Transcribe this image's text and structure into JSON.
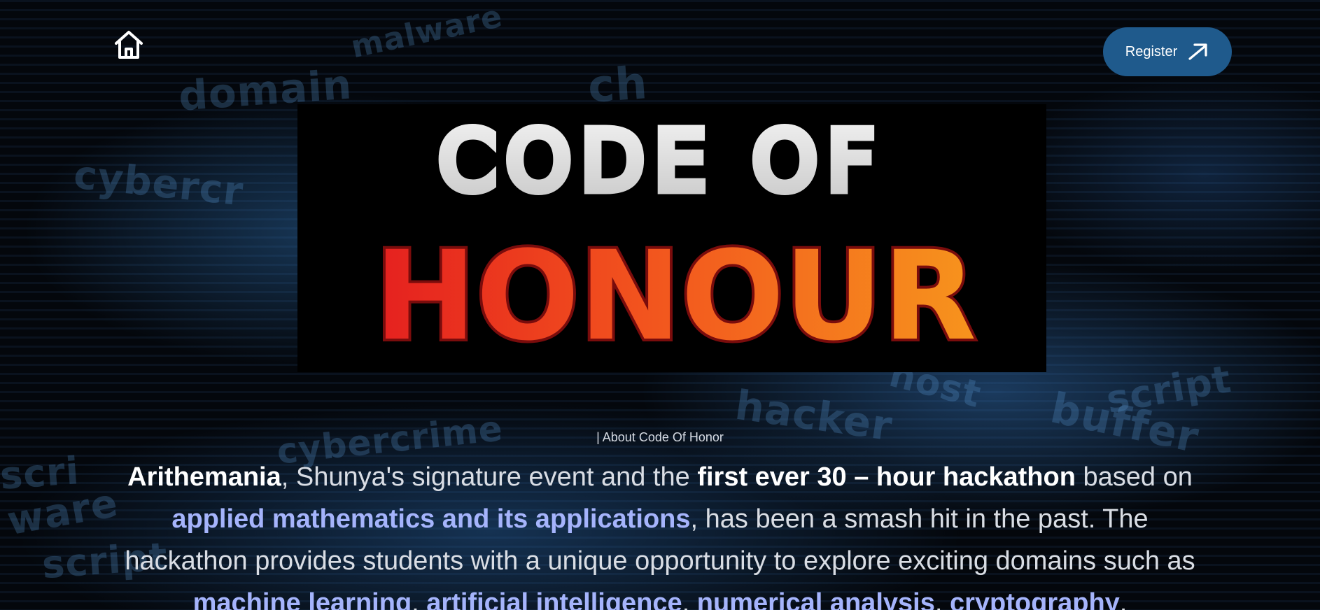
{
  "nav": {
    "home_icon": "home-icon",
    "register_label": "Register",
    "register_icon": "arrow-up-right-icon",
    "register_color": "#1f5a8c"
  },
  "logo": {
    "line1": "CODE OF",
    "line2": "HONOUR"
  },
  "background_words": [
    "domain",
    "malware",
    "cybercr",
    "ch",
    "host",
    "buffer",
    "hacker",
    "script",
    "cybercrime",
    "scri",
    "ware",
    "script"
  ],
  "about": {
    "label": "| About Code Of Honor",
    "segments": [
      {
        "text": "Arithemania",
        "style": "white"
      },
      {
        "text": ", Shunya's signature event and the ",
        "style": "plain"
      },
      {
        "text": "first ever 30 – hour hackathon",
        "style": "white"
      },
      {
        "text": " based on ",
        "style": "plain"
      },
      {
        "text": "applied mathematics and its applications",
        "style": "blue"
      },
      {
        "text": ", has been a smash hit in the past. The hackathon provides students with a unique opportunity to explore exciting domains such as ",
        "style": "plain"
      },
      {
        "text": "machine learning",
        "style": "blue"
      },
      {
        "text": ", ",
        "style": "plain"
      },
      {
        "text": "artificial intelligence",
        "style": "blue"
      },
      {
        "text": ", ",
        "style": "plain"
      },
      {
        "text": "numerical analysis",
        "style": "blue"
      },
      {
        "text": ", ",
        "style": "plain"
      },
      {
        "text": "cryptography",
        "style": "blue"
      },
      {
        "text": ",",
        "style": "plain"
      }
    ]
  }
}
